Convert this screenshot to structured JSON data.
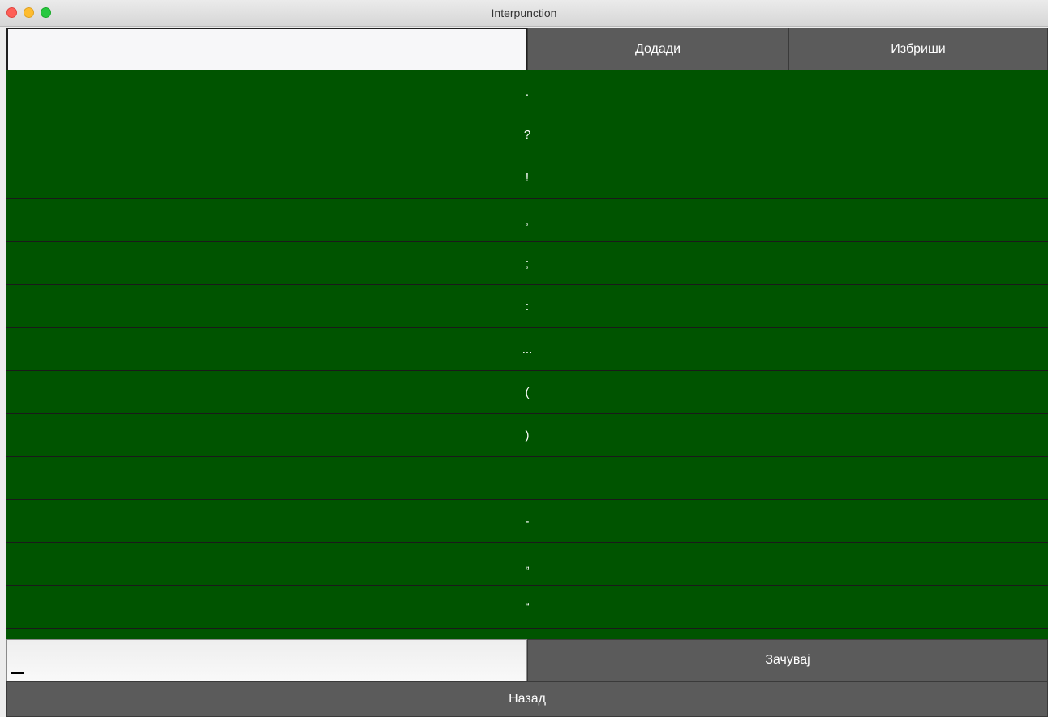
{
  "window": {
    "title": "Interpunction"
  },
  "top_input": {
    "value": ""
  },
  "toolbar": {
    "add_label": "Додади",
    "delete_label": "Избриши"
  },
  "list": {
    "items": [
      ".",
      "?",
      "!",
      ",",
      ";",
      ":",
      "...",
      "(",
      ")",
      "_",
      "-",
      "„",
      "“",
      ""
    ]
  },
  "bottom_input": {
    "value": ""
  },
  "footer": {
    "save_label": "Зачувај",
    "back_label": "Назад"
  },
  "colors": {
    "list_bg": "#005400",
    "button_bg": "#5b5b5b"
  }
}
